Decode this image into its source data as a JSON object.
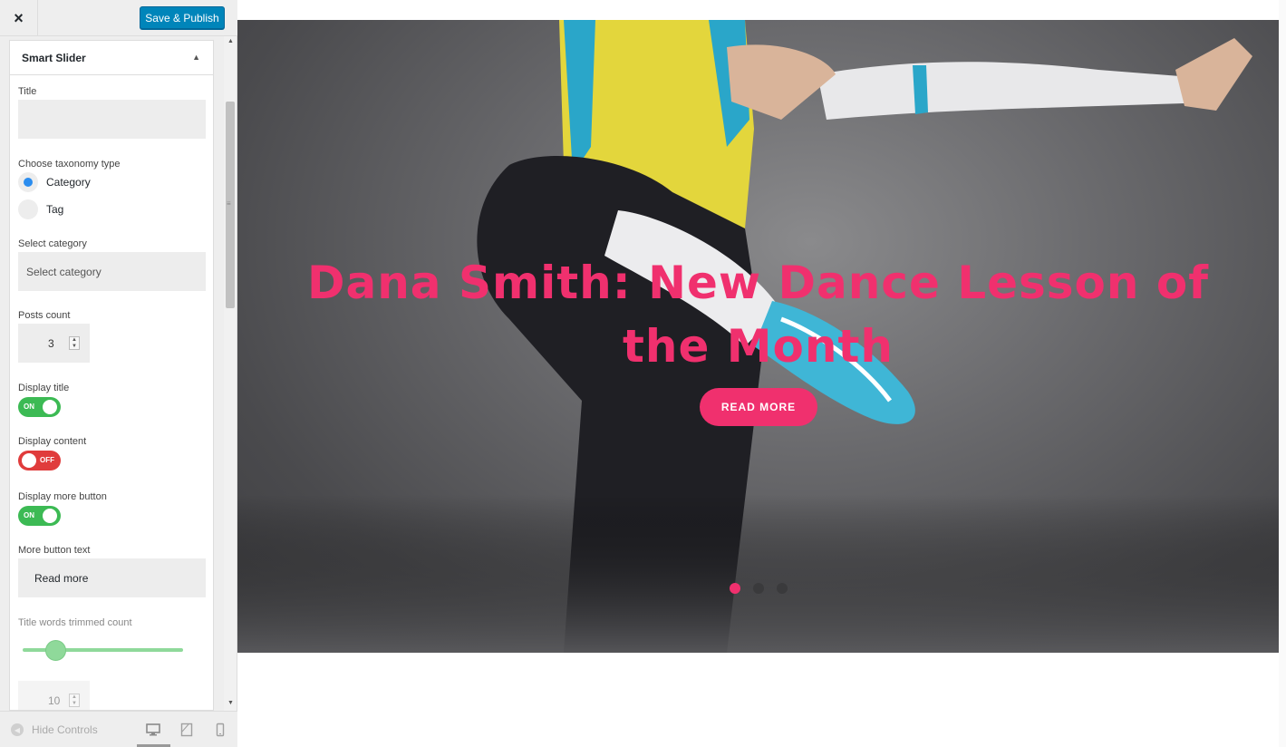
{
  "topbar": {
    "close_icon": "×",
    "save_label": "Save & Publish"
  },
  "section": {
    "title": "Smart Slider"
  },
  "controls": {
    "title_label": "Title",
    "title_value": "",
    "taxonomy_label": "Choose taxonomy type",
    "taxonomy_options": [
      "Category",
      "Tag"
    ],
    "taxonomy_selected": "Category",
    "select_category_label": "Select category",
    "select_category_value": "Select category",
    "posts_count_label": "Posts count",
    "posts_count_value": "3",
    "display_title_label": "Display title",
    "display_title_state": "ON",
    "display_content_label": "Display content",
    "display_content_state": "OFF",
    "display_more_label": "Display more button",
    "display_more_state": "ON",
    "more_text_label": "More button text",
    "more_text_value": "Read more",
    "trim_label": "Title words trimmed count",
    "trim_slider_fraction": 0.2,
    "trim_value": "10"
  },
  "footer": {
    "hide_controls": "Hide Controls",
    "devices": [
      "desktop-icon",
      "tablet-icon",
      "mobile-icon"
    ],
    "active_device": "desktop"
  },
  "preview": {
    "hero_title": "Dana Smith: New Dance Lesson of the Month",
    "button_label": "READ MORE",
    "slide_count": 3,
    "active_slide": 1,
    "accent": "#f0306e"
  }
}
